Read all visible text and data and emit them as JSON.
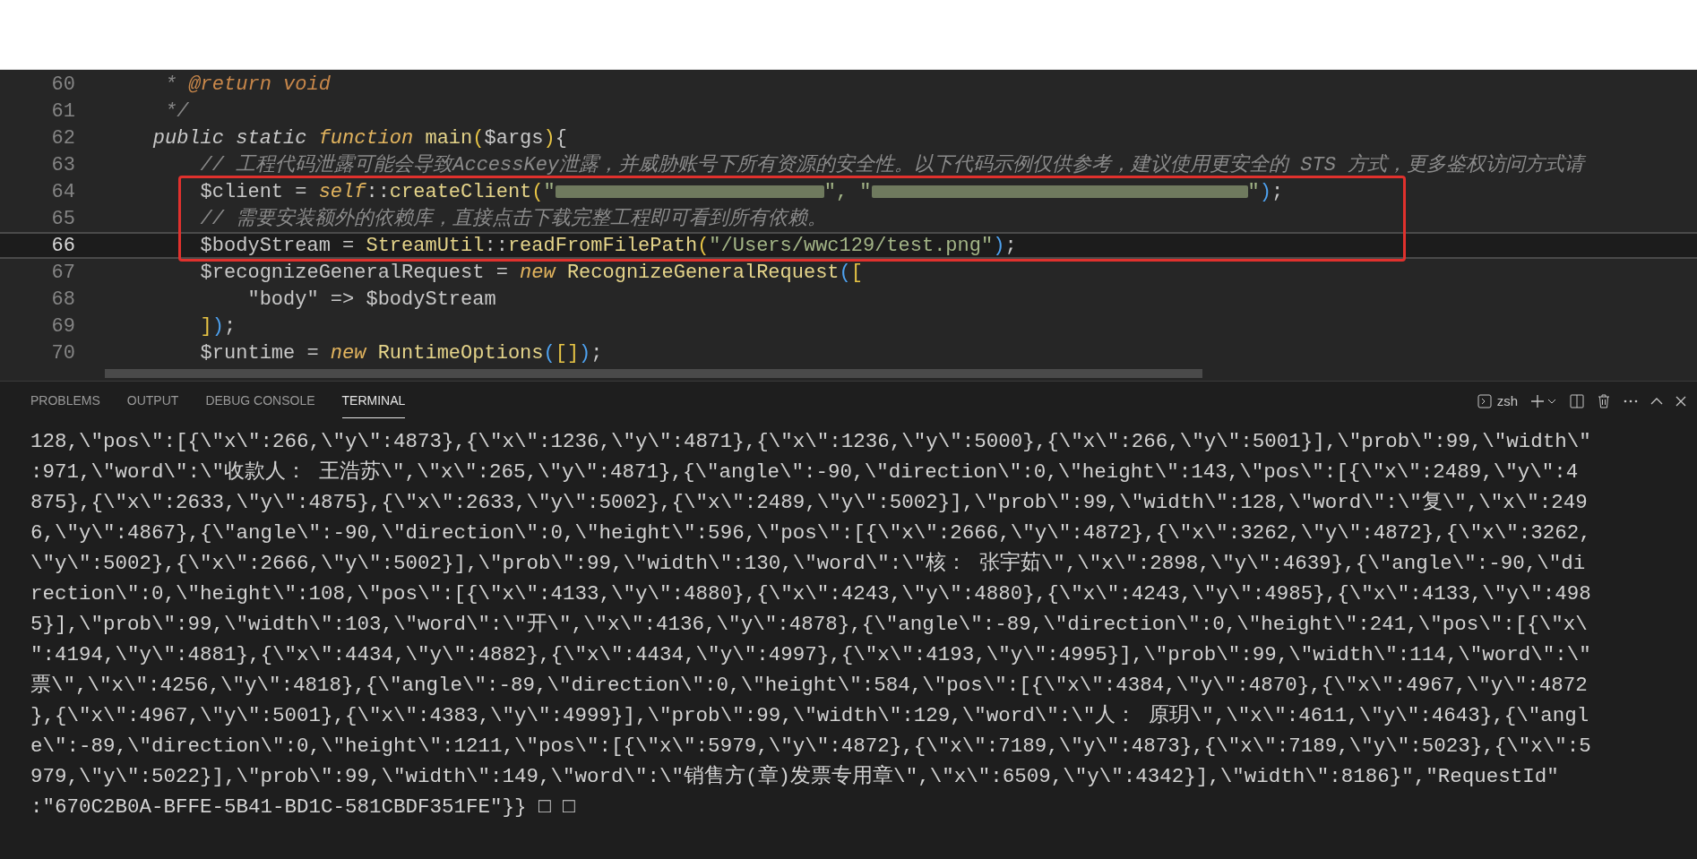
{
  "editor": {
    "lines": [
      {
        "number": "60",
        "current": false,
        "tokens": [
          {
            "kind": "doc",
            "text": "     * "
          },
          {
            "kind": "doctag",
            "text": "@return void"
          }
        ]
      },
      {
        "number": "61",
        "current": false,
        "tokens": [
          {
            "kind": "doc",
            "text": "     */"
          }
        ]
      },
      {
        "number": "62",
        "current": false,
        "tokens": [
          {
            "kind": "keyword",
            "text": "    public static "
          },
          {
            "kind": "storage",
            "text": "function "
          },
          {
            "kind": "func",
            "text": "main"
          },
          {
            "kind": "bracket",
            "text": "("
          },
          {
            "kind": "var",
            "text": "$args"
          },
          {
            "kind": "bracket",
            "text": ")"
          },
          {
            "kind": "punct",
            "text": "{"
          }
        ]
      },
      {
        "number": "63",
        "current": false,
        "tokens": [
          {
            "kind": "comment",
            "text": "        // 工程代码泄露可能会导致AccessKey泄露，并威胁账号下所有资源的安全性。以下代码示例仅供参考，建议使用更安全的 STS 方式，更多鉴权访问方式请"
          }
        ]
      },
      {
        "number": "64",
        "current": false,
        "tokens": [
          {
            "kind": "var",
            "text": "        $client = "
          },
          {
            "kind": "storage",
            "text": "self"
          },
          {
            "kind": "punct",
            "text": "::"
          },
          {
            "kind": "func",
            "text": "createClient"
          },
          {
            "kind": "bracket",
            "text": "("
          },
          {
            "kind": "string",
            "text": "\""
          },
          {
            "kind": "redacted"
          },
          {
            "kind": "string",
            "text": "\", \""
          },
          {
            "kind": "redacted"
          },
          {
            "kind": "string",
            "text": "\""
          },
          {
            "kind": "paren",
            "text": ")"
          },
          {
            "kind": "punct",
            "text": ";"
          }
        ]
      },
      {
        "number": "65",
        "current": false,
        "tokens": [
          {
            "kind": "comment",
            "text": "        // 需要安装额外的依赖库，直接点击下载完整工程即可看到所有依赖。"
          }
        ]
      },
      {
        "number": "66",
        "current": true,
        "tokens": [
          {
            "kind": "var",
            "text": "        $bodyStream = "
          },
          {
            "kind": "func",
            "text": "StreamUtil"
          },
          {
            "kind": "punct",
            "text": "::"
          },
          {
            "kind": "func",
            "text": "readFromFilePath"
          },
          {
            "kind": "bracket",
            "text": "("
          },
          {
            "kind": "string",
            "text": "\"/Users/wwc129/test.png\""
          },
          {
            "kind": "paren",
            "text": ")"
          },
          {
            "kind": "punct",
            "text": ";"
          }
        ]
      },
      {
        "number": "67",
        "current": false,
        "tokens": [
          {
            "kind": "var",
            "text": "        $recognizeGeneralRequest = "
          },
          {
            "kind": "storage",
            "text": "new "
          },
          {
            "kind": "func",
            "text": "RecognizeGeneralRequest"
          },
          {
            "kind": "paren",
            "text": "("
          },
          {
            "kind": "bracket",
            "text": "["
          }
        ]
      },
      {
        "number": "68",
        "current": false,
        "tokens": [
          {
            "kind": "var",
            "text": "            \"body\" => $bodyStream"
          }
        ]
      },
      {
        "number": "69",
        "current": false,
        "tokens": [
          {
            "kind": "bracket",
            "text": "        ]"
          },
          {
            "kind": "paren",
            "text": ")"
          },
          {
            "kind": "punct",
            "text": ";"
          }
        ]
      },
      {
        "number": "70",
        "current": false,
        "tokens": [
          {
            "kind": "var",
            "text": "        $runtime = "
          },
          {
            "kind": "storage",
            "text": "new "
          },
          {
            "kind": "func",
            "text": "RuntimeOptions"
          },
          {
            "kind": "paren",
            "text": "("
          },
          {
            "kind": "bracket",
            "text": "[]"
          },
          {
            "kind": "paren",
            "text": ")"
          },
          {
            "kind": "punct",
            "text": ";"
          }
        ]
      }
    ]
  },
  "panel": {
    "tabs": [
      {
        "label": "PROBLEMS",
        "selected": false
      },
      {
        "label": "OUTPUT",
        "selected": false
      },
      {
        "label": "DEBUG CONSOLE",
        "selected": false
      },
      {
        "label": "TERMINAL",
        "selected": true
      }
    ],
    "shell": "zsh",
    "terminal_lines": [
      "128,\\\"pos\\\":[{\\\"x\\\":266,\\\"y\\\":4873},{\\\"x\\\":1236,\\\"y\\\":4871},{\\\"x\\\":1236,\\\"y\\\":5000},{\\\"x\\\":266,\\\"y\\\":5001}],\\\"prob\\\":99,\\\"width\\\"",
      ":971,\\\"word\\\":\\\"收款人： 王浩苏\\\",\\\"x\\\":265,\\\"y\\\":4871},{\\\"angle\\\":-90,\\\"direction\\\":0,\\\"height\\\":143,\\\"pos\\\":[{\\\"x\\\":2489,\\\"y\\\":4",
      "875},{\\\"x\\\":2633,\\\"y\\\":4875},{\\\"x\\\":2633,\\\"y\\\":5002},{\\\"x\\\":2489,\\\"y\\\":5002}],\\\"prob\\\":99,\\\"width\\\":128,\\\"word\\\":\\\"复\\\",\\\"x\\\":249",
      "6,\\\"y\\\":4867},{\\\"angle\\\":-90,\\\"direction\\\":0,\\\"height\\\":596,\\\"pos\\\":[{\\\"x\\\":2666,\\\"y\\\":4872},{\\\"x\\\":3262,\\\"y\\\":4872},{\\\"x\\\":3262,",
      "\\\"y\\\":5002},{\\\"x\\\":2666,\\\"y\\\":5002}],\\\"prob\\\":99,\\\"width\\\":130,\\\"word\\\":\\\"核： 张宇茹\\\",\\\"x\\\":2898,\\\"y\\\":4639},{\\\"angle\\\":-90,\\\"di",
      "rection\\\":0,\\\"height\\\":108,\\\"pos\\\":[{\\\"x\\\":4133,\\\"y\\\":4880},{\\\"x\\\":4243,\\\"y\\\":4880},{\\\"x\\\":4243,\\\"y\\\":4985},{\\\"x\\\":4133,\\\"y\\\":498",
      "5}],\\\"prob\\\":99,\\\"width\\\":103,\\\"word\\\":\\\"开\\\",\\\"x\\\":4136,\\\"y\\\":4878},{\\\"angle\\\":-89,\\\"direction\\\":0,\\\"height\\\":241,\\\"pos\\\":[{\\\"x\\",
      "\":4194,\\\"y\\\":4881},{\\\"x\\\":4434,\\\"y\\\":4882},{\\\"x\\\":4434,\\\"y\\\":4997},{\\\"x\\\":4193,\\\"y\\\":4995}],\\\"prob\\\":99,\\\"width\\\":114,\\\"word\\\":\\\"",
      "票\\\",\\\"x\\\":4256,\\\"y\\\":4818},{\\\"angle\\\":-89,\\\"direction\\\":0,\\\"height\\\":584,\\\"pos\\\":[{\\\"x\\\":4384,\\\"y\\\":4870},{\\\"x\\\":4967,\\\"y\\\":4872",
      "},{\\\"x\\\":4967,\\\"y\\\":5001},{\\\"x\\\":4383,\\\"y\\\":4999}],\\\"prob\\\":99,\\\"width\\\":129,\\\"word\\\":\\\"人： 原玥\\\",\\\"x\\\":4611,\\\"y\\\":4643},{\\\"angl",
      "e\\\":-89,\\\"direction\\\":0,\\\"height\\\":1211,\\\"pos\\\":[{\\\"x\\\":5979,\\\"y\\\":4872},{\\\"x\\\":7189,\\\"y\\\":4873},{\\\"x\\\":7189,\\\"y\\\":5023},{\\\"x\\\":5",
      "979,\\\"y\\\":5022}],\\\"prob\\\":99,\\\"width\\\":149,\\\"word\\\":\\\"销售方(章)发票专用章\\\",\\\"x\\\":6509,\\\"y\\\":4342}],\\\"width\\\":8186}\",\"RequestId\"",
      ":\"670C2B0A-BFFE-5B41-BD1C-581CBDF351FE\"}} □ □"
    ]
  }
}
